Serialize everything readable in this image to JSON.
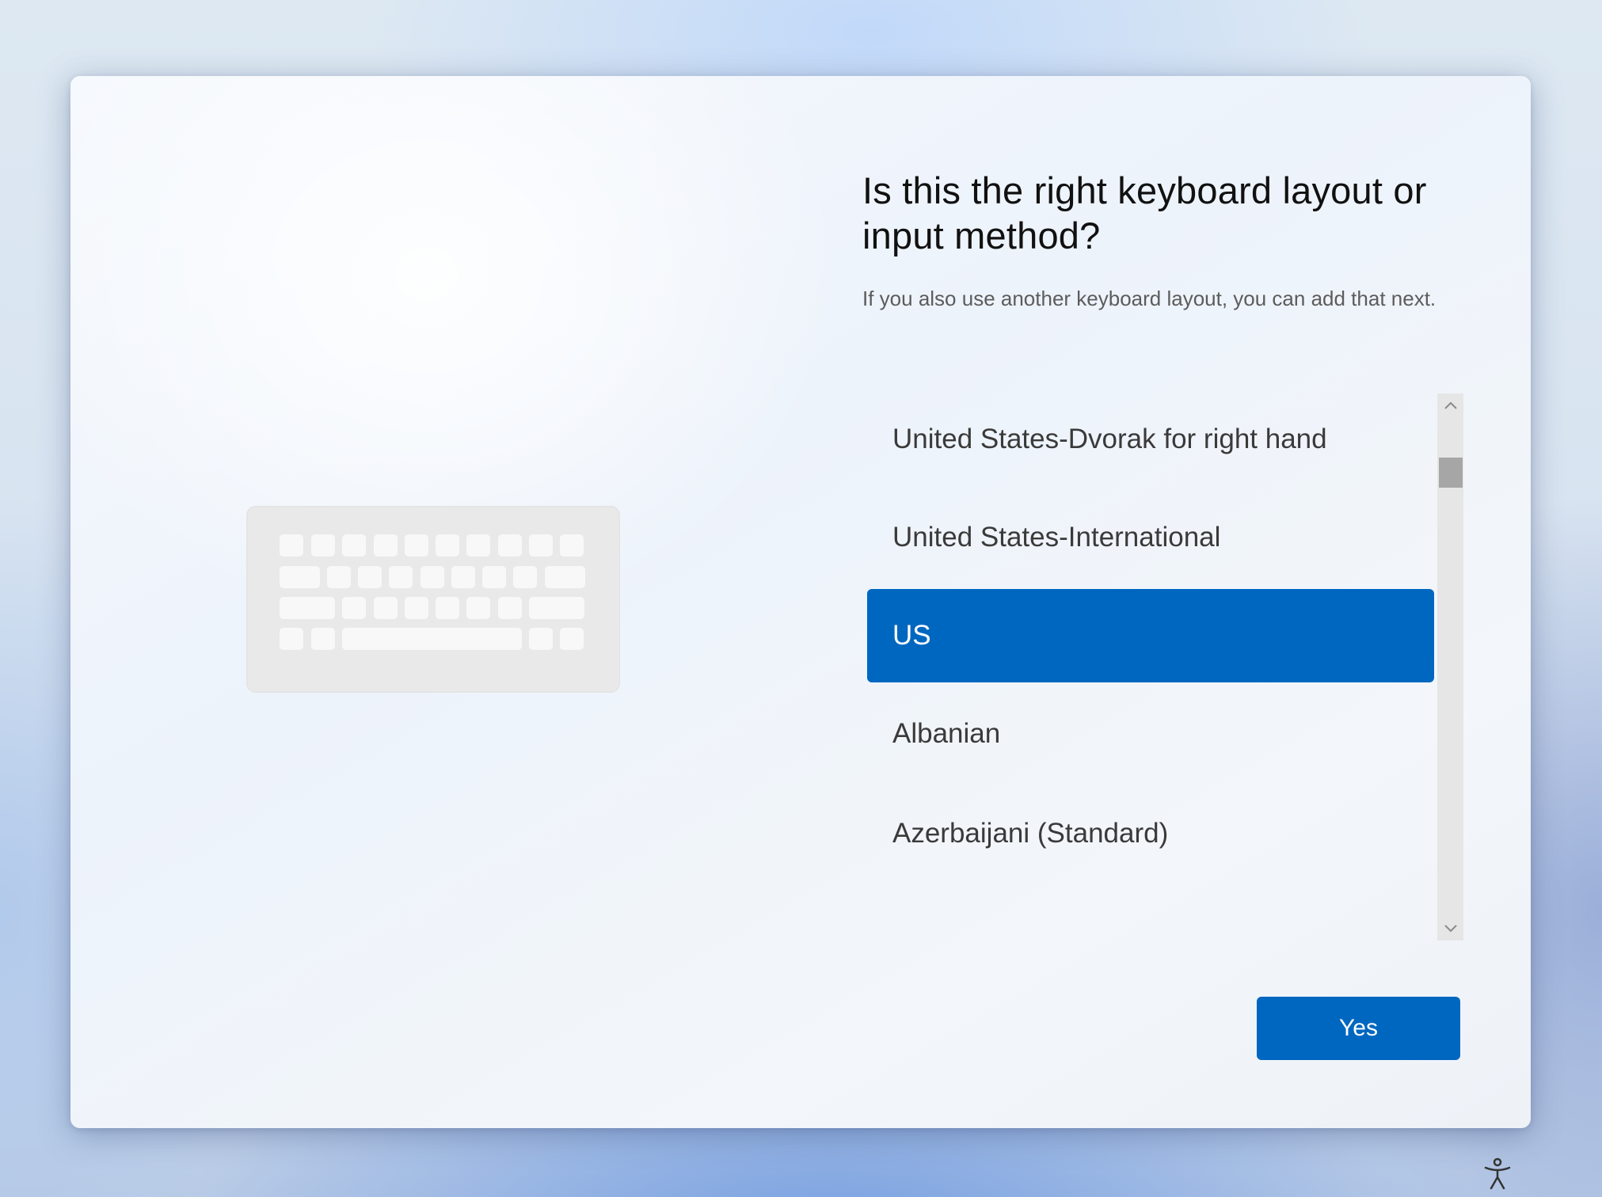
{
  "page": {
    "title": "Is this the right keyboard layout or input method?",
    "subtitle": "If you also use another keyboard layout, you can add that next."
  },
  "layouts": {
    "items": [
      {
        "label": "United States-Dvorak for right hand",
        "selected": false
      },
      {
        "label": "United States-International",
        "selected": false
      },
      {
        "label": "US",
        "selected": true
      },
      {
        "label": "Albanian",
        "selected": false
      },
      {
        "label": "Azerbaijani (Standard)",
        "selected": false
      }
    ]
  },
  "actions": {
    "yes_label": "Yes"
  },
  "icons": {
    "illustration": "keyboard-icon",
    "scroll_up": "chevron-up-icon",
    "scroll_down": "chevron-down-icon",
    "accessibility": "accessibility-icon"
  },
  "colors": {
    "accent": "#0067c0",
    "text_primary": "#111111",
    "text_secondary": "#5c5c5c"
  }
}
